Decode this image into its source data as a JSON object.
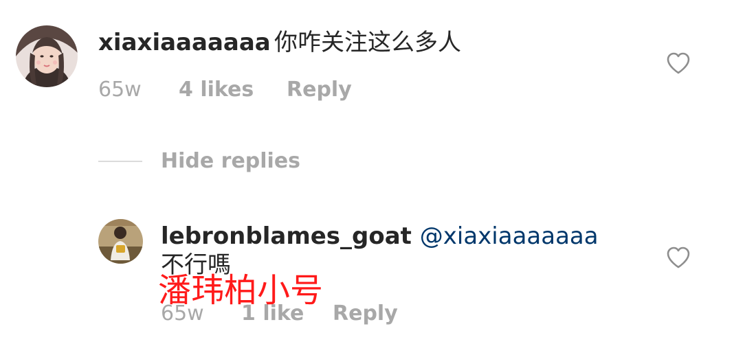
{
  "comment": {
    "username": "xiaxiaaaaaaa",
    "text": "你咋关注这么多人",
    "time": "65w",
    "likes": "4 likes",
    "reply_label": "Reply",
    "like_icon": "heart-outline-icon"
  },
  "replies_toggle": {
    "label": "Hide replies"
  },
  "reply": {
    "username": "lebronblames_goat",
    "mention": "@xiaxiaaaaaaa",
    "text": "不行嗎",
    "time": "65w",
    "likes": "1 like",
    "reply_label": "Reply",
    "like_icon": "heart-outline-icon"
  },
  "overlay": {
    "text": "潘玮柏小号",
    "color": "#ff1a1a"
  },
  "colors": {
    "text_primary": "#262626",
    "text_secondary": "#a8a8a8",
    "mention": "#00376b",
    "divider": "#dbdbdb"
  }
}
